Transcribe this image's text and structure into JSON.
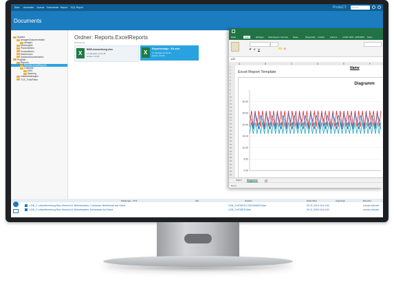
{
  "topbar": {
    "menu": [
      "Start",
      "Anmelden",
      "Journal",
      "Dokumente",
      "Report",
      "SQL Report"
    ],
    "logo": "ProduCT",
    "search_placeholder": "Suchen"
  },
  "app": {
    "title": "Documents"
  },
  "sidebar": {
    "items": [
      {
        "label": "System",
        "level": 0
      },
      {
        "label": "AnlagenDokumentation",
        "level": 1
      },
      {
        "label": "Anlage1",
        "level": 2
      },
      {
        "label": "Messregeln",
        "level": 1
      },
      {
        "label": "Planerstellen",
        "level": 1
      },
      {
        "label": "Produktlinien",
        "level": 1
      },
      {
        "label": "Referenzen",
        "level": 1
      },
      {
        "label": "Systemdokumentation",
        "level": 1
      },
      {
        "label": "Projekte",
        "level": 0
      },
      {
        "label": "Reports",
        "level": 1
      },
      {
        "label": "Reports.ExcelReports",
        "level": 2,
        "selected": true
      },
      {
        "label": "Luftwerte",
        "level": 2
      },
      {
        "label": "EMS",
        "level": 3
      },
      {
        "label": "Wartung",
        "level": 3
      },
      {
        "label": "Instandhaltungen",
        "level": 1
      },
      {
        "label": "TCS_TrafoPlans",
        "level": 1
      }
    ]
  },
  "main": {
    "folder_label": "Ordner:",
    "folder_name": "Reports.ExcelReports",
    "subpath": "Dokumente",
    "files": [
      {
        "name": "BMS-Auswertung.xlsx",
        "meta1": "17.08.2016 11:15:48",
        "meta2": "Größe: 16 KB",
        "selected": false
      },
      {
        "name": "Reportvorlage - EA.xlsx",
        "meta1": "17.08.2016 11:22:40",
        "meta2": "Größe: 34 KB",
        "selected": true
      }
    ]
  },
  "excel": {
    "tabs": [
      "Datei",
      "Start",
      "Einfügen",
      "Seitenlayout",
      "Formeln",
      "Daten",
      "Überprüfen",
      "Ansicht",
      "Add-Ins",
      "LOAD TEST",
      "ACROBAT",
      "Team"
    ],
    "active_tab": "Start",
    "cell_ref": "A12",
    "columns": [
      "A",
      "B",
      "C",
      "D",
      "E",
      "F"
    ],
    "template_title": "Excel-Report Template",
    "name_label": "Name",
    "sheets": [
      "Daten",
      "Diagramm"
    ],
    "active_sheet": "Diagramm",
    "status": "Bereit"
  },
  "chart_data": {
    "type": "line",
    "title": "Diagramm",
    "xlabel": "",
    "ylabel": "",
    "ylim": [
      0,
      35
    ],
    "yticks": [
      0,
      5,
      10,
      15,
      20,
      25,
      30
    ],
    "x": [
      0,
      1,
      2,
      3,
      4,
      5,
      6,
      7,
      8,
      9,
      10,
      11,
      12,
      13,
      14,
      15,
      16,
      17,
      18,
      19,
      20,
      21,
      22,
      23,
      24,
      25,
      26,
      27,
      28,
      29,
      30,
      31,
      32,
      33,
      34,
      35,
      36,
      37,
      38,
      39,
      40,
      41,
      42,
      43,
      44,
      45,
      46,
      47,
      48,
      49,
      50,
      51,
      52,
      53,
      54,
      55,
      56,
      57,
      58,
      59,
      60,
      61,
      62,
      63,
      64,
      65,
      66,
      67,
      68,
      69,
      70,
      71
    ],
    "series": [
      {
        "color": "#e0242b",
        "values": [
          19,
          26,
          19,
          26,
          19,
          26,
          19,
          26,
          19,
          26,
          19,
          26,
          19,
          26,
          19,
          26,
          19,
          26,
          19,
          26,
          19,
          26,
          19,
          26,
          19,
          26,
          19,
          26,
          19,
          26,
          19,
          26,
          19,
          26,
          19,
          26,
          19,
          26,
          19,
          26,
          19,
          26,
          19,
          26,
          19,
          26,
          19,
          26,
          19,
          26,
          19,
          26,
          19,
          26,
          19,
          26,
          19,
          26,
          19,
          26,
          19,
          26,
          19,
          26,
          19,
          26,
          19,
          26,
          19,
          26,
          19,
          26
        ]
      },
      {
        "color": "#2a6fc0",
        "values": [
          24,
          22,
          18,
          25,
          22,
          18,
          24,
          22,
          18,
          25,
          22,
          18,
          24,
          22,
          18,
          25,
          22,
          18,
          24,
          22,
          18,
          25,
          22,
          18,
          24,
          22,
          18,
          25,
          22,
          18,
          24,
          22,
          18,
          25,
          22,
          18,
          24,
          22,
          18,
          25,
          22,
          18,
          24,
          22,
          18,
          25,
          22,
          18,
          24,
          22,
          18,
          25,
          22,
          18,
          24,
          22,
          18,
          25,
          22,
          18,
          24,
          22,
          18,
          25,
          22,
          18,
          24,
          22,
          18,
          25,
          22,
          18
        ]
      },
      {
        "color": "#17a2b8",
        "values": [
          16,
          21,
          16,
          21,
          16,
          21,
          16,
          21,
          16,
          21,
          16,
          21,
          16,
          21,
          16,
          21,
          16,
          21,
          16,
          21,
          16,
          21,
          16,
          21,
          16,
          21,
          16,
          21,
          16,
          21,
          16,
          21,
          16,
          21,
          16,
          21,
          16,
          21,
          16,
          21,
          16,
          21,
          16,
          21,
          16,
          21,
          16,
          21,
          16,
          21,
          16,
          21,
          16,
          21,
          16,
          21,
          16,
          21,
          16,
          21,
          16,
          21,
          16,
          21,
          16,
          21,
          16,
          21,
          16,
          21,
          16,
          21
        ]
      }
    ]
  },
  "bottom": {
    "headers": [
      "Meldungen - 2/73",
      "Alle",
      "Position",
      "Datum/Zeit",
      "Angezeigt",
      "Benutzer"
    ],
    "rows": [
      {
        "text": "LDB_2 Luftaufbereitung Büro Bereich A: Betriebsarten: Container: Betriebsart auf Hand",
        "position": "LDB_2.MODES.CONTAINER.Man",
        "time": "09.11.2016 18:14:52",
        "user": "roman.ruthofer"
      },
      {
        "text": "LDB_2 Luftaufbereitung Büro Bereich A: Betriebsarten: Betriebsart auf Hand",
        "position": "LDB_2.MODES.Man",
        "time": "09.11.2016 18:14:52",
        "user": "roman.ruthofer"
      }
    ]
  },
  "colors": {
    "accent": "#1b7cbf",
    "excel": "#217346",
    "selected": "#29a3e0"
  }
}
